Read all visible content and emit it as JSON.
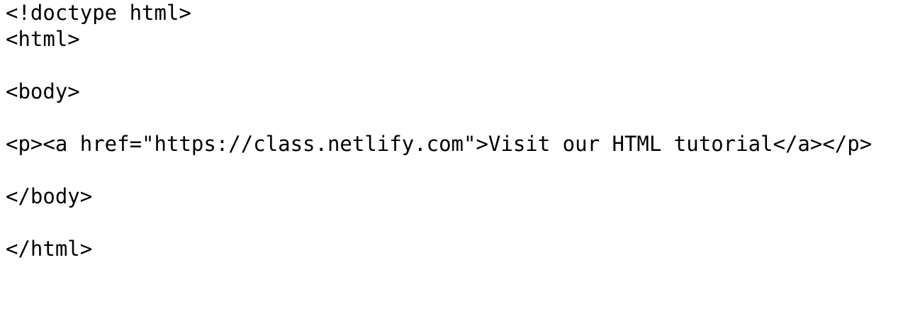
{
  "code_lines": [
    "<!doctype html>",
    "<html>",
    "",
    "<body>",
    "",
    "<p><a href=\"https://class.netlify.com\">Visit our HTML tutorial</a></p>",
    "",
    "</body>",
    "",
    "</html>"
  ]
}
